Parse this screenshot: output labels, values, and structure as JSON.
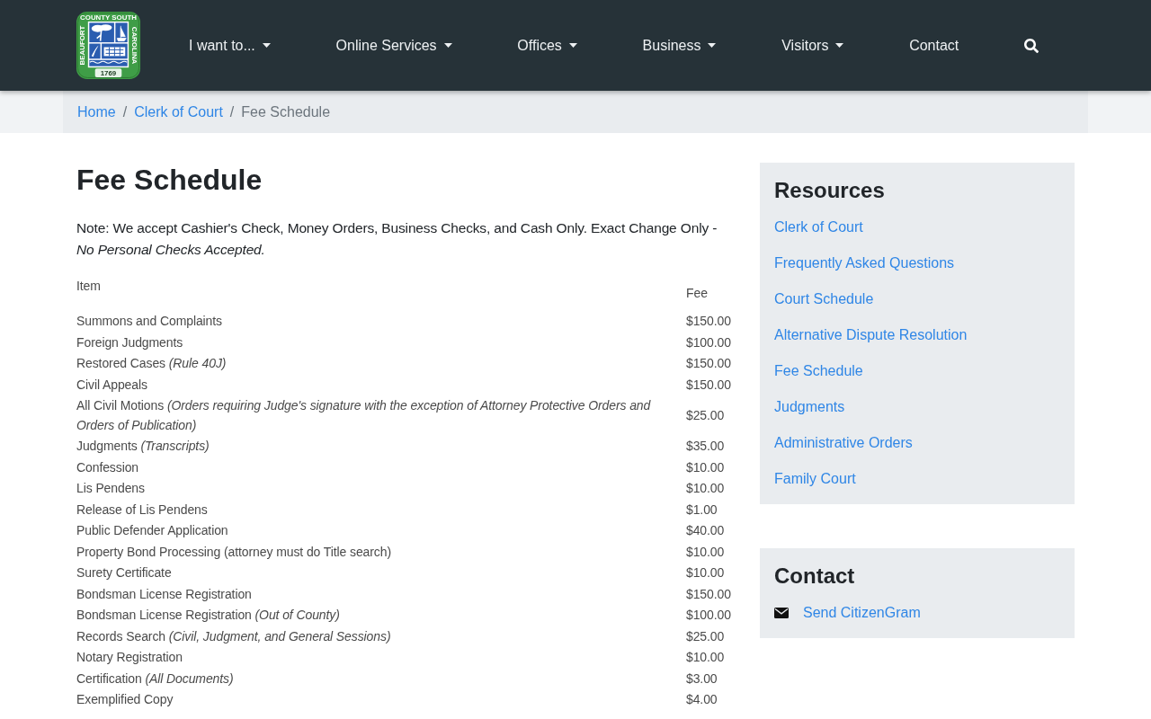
{
  "logo": {
    "seal_text": {
      "left": "BEAUFORT",
      "top": "COUNTY SOUTH",
      "right": "CAROLINA"
    },
    "year": "1769"
  },
  "nav": {
    "items": [
      {
        "label": "I want to...",
        "dropdown": true
      },
      {
        "label": "Online Services",
        "dropdown": true
      },
      {
        "label": "Offices",
        "dropdown": true
      },
      {
        "label": "Business",
        "dropdown": true
      },
      {
        "label": "Visitors",
        "dropdown": true
      },
      {
        "label": "Contact",
        "dropdown": false
      }
    ]
  },
  "breadcrumb": {
    "items": [
      {
        "label": "Home",
        "current": false
      },
      {
        "separator": "/",
        "label": "Clerk of Court",
        "current": false
      },
      {
        "separator": "/",
        "label": "Fee Schedule",
        "current": true
      }
    ]
  },
  "page": {
    "title": "Fee Schedule",
    "note": "Note: We accept Cashier's Check, Money Orders, Business Checks, and Cash Only. Exact Change Only - *No Personal Checks Accepted.*"
  },
  "fee_table": {
    "columns": [
      "Item",
      "Fee"
    ],
    "rows": [
      {
        "item": "Summons and Complaints",
        "fee": "$150.00"
      },
      {
        "item": "Foreign Judgments",
        "fee": "$100.00"
      },
      {
        "item": "Restored Cases *(Rule 40J)*",
        "fee": "$150.00"
      },
      {
        "item": "Civil Appeals",
        "fee": "$150.00"
      },
      {
        "item": "All Civil Motions *(Orders requiring Judge's signature with the exception of Attorney Protective Orders and Orders of Publication)*",
        "fee": "$25.00"
      },
      {
        "item": "Judgments *(Transcripts)*",
        "fee": "$35.00"
      },
      {
        "item": "Confession",
        "fee": "$10.00"
      },
      {
        "item": "Lis Pendens",
        "fee": "$10.00"
      },
      {
        "item": "Release of Lis Pendens",
        "fee": "$1.00"
      },
      {
        "item": "Public Defender Application",
        "fee": "$40.00"
      },
      {
        "item": "Property Bond Processing (attorney must do Title search)",
        "fee": "$10.00"
      },
      {
        "item": "Surety Certificate",
        "fee": "$10.00"
      },
      {
        "item": "Bondsman License Registration",
        "fee": "$150.00"
      },
      {
        "item": "Bondsman License Registration *(Out of County)*",
        "fee": "$100.00"
      },
      {
        "item": "Records Search *(Civil, Judgment, and General Sessions)*",
        "fee": "$25.00"
      },
      {
        "item": "Notary Registration",
        "fee": "$10.00"
      },
      {
        "item": "Certification *(All Documents)*",
        "fee": "$3.00"
      },
      {
        "item": "Exemplified Copy",
        "fee": "$4.00"
      }
    ]
  },
  "sidebar": {
    "resources": {
      "title": "Resources",
      "links": [
        "Clerk of Court",
        "Frequently Asked Questions",
        "Court Schedule",
        "Alternative Dispute Resolution",
        "Fee Schedule",
        "Judgments",
        "Administrative Orders",
        "Family Court"
      ]
    },
    "contact": {
      "title": "Contact",
      "links": [
        {
          "kind": "email",
          "label": "Send CitizenGram"
        }
      ]
    }
  }
}
